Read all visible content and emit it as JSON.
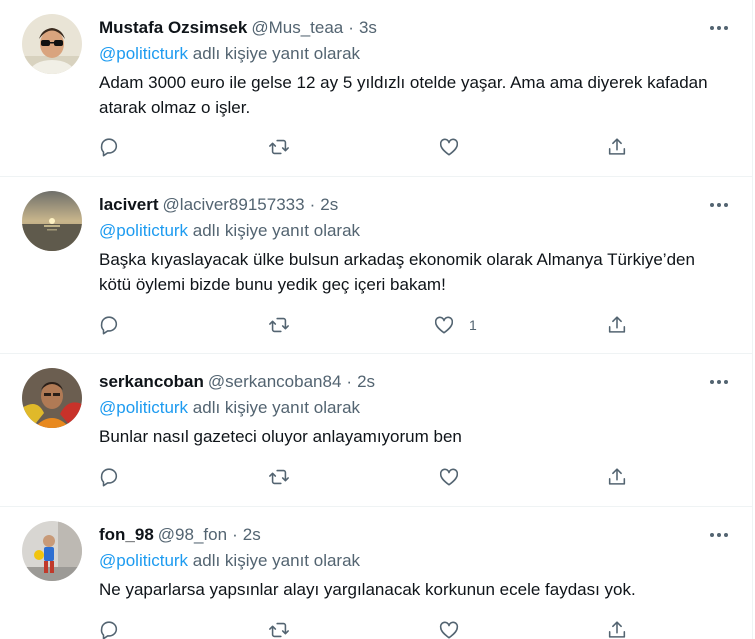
{
  "reply_suffix": "adlı kişiye yanıt olarak",
  "colors": {
    "accent": "#1d9bf0",
    "secondary_text": "#536471",
    "border": "#eff3f4"
  },
  "icons": {
    "reply": "reply-icon",
    "retweet": "retweet-icon",
    "like": "like-icon",
    "share": "share-icon",
    "more": "more-icon"
  },
  "tweets": [
    {
      "name": "Mustafa Ozsimsek",
      "handle": "@Mus_teaa",
      "separator": "·",
      "time": "3s",
      "reply_to": "@politicturk",
      "text": "Adam 3000 euro ile gelse 12 ay 5 yıldızlı otelde yaşar. Ama ama diyerek kafadan atarak olmaz o işler.",
      "like_count": ""
    },
    {
      "name": "lacivert",
      "handle": "@laciver89157333",
      "separator": "·",
      "time": "2s",
      "reply_to": "@politicturk",
      "text": "Başka kıyaslayacak ülke bulsun arkadaş ekonomik olarak Almanya Türkiye’den kötü öylemi bizde bunu yedik geç içeri bakam!",
      "like_count": "1"
    },
    {
      "name": "serkancoban",
      "handle": "@serkancoban84",
      "separator": "·",
      "time": "2s",
      "reply_to": "@politicturk",
      "text": "Bunlar nasıl gazeteci oluyor anlayamıyorum ben",
      "like_count": ""
    },
    {
      "name": "fon_98",
      "handle": "@98_fon",
      "separator": "·",
      "time": "2s",
      "reply_to": "@politicturk",
      "text": "Ne yaparlarsa yapsınlar alayı yargılanacak korkunun ecele faydası yok.",
      "like_count": ""
    }
  ]
}
